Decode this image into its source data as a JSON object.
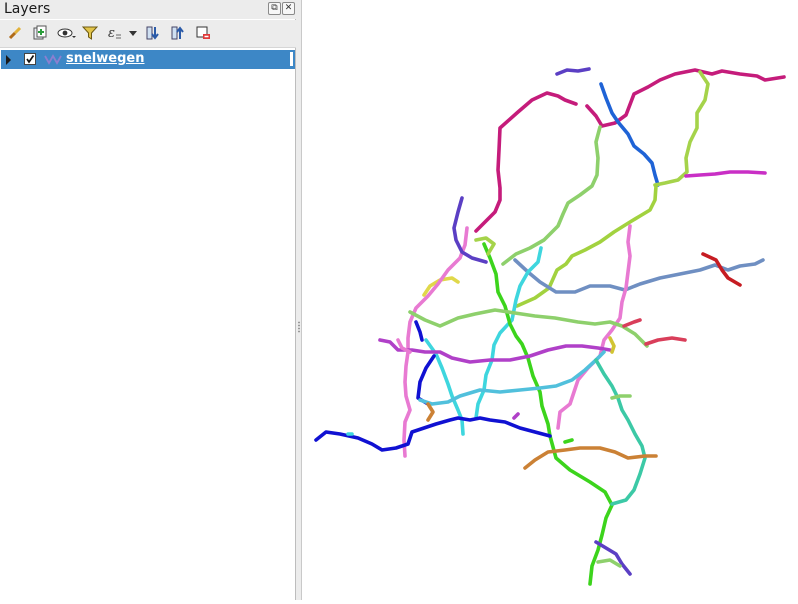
{
  "panel": {
    "title": "Layers",
    "float_icon": "float-panel-icon",
    "close_icon": "close-panel-icon"
  },
  "toolbar": {
    "buttons": [
      {
        "icon": "style-brush-icon"
      },
      {
        "icon": "add-group-icon"
      },
      {
        "icon": "visibility-eye-icon"
      },
      {
        "icon": "filter-funnel-icon"
      },
      {
        "icon": "filter-expression-icon"
      },
      {
        "icon": "expand-all-icon"
      },
      {
        "icon": "collapse-all-icon"
      },
      {
        "icon": "remove-layer-icon"
      }
    ]
  },
  "layers": [
    {
      "name": "snelwegen",
      "visible": true,
      "selected": true,
      "type": "line"
    }
  ],
  "map": {
    "road_colors": [
      "#c51c7b",
      "#5b3fc4",
      "#1f63d6",
      "#a5d34a",
      "#c92fc5",
      "#8ed06c",
      "#4fe39b",
      "#a2d23f",
      "#6f8fc2",
      "#e0d84a",
      "#3ed6de",
      "#3cd41c",
      "#e87ad2",
      "#b040c8",
      "#1011d2",
      "#51c0dc",
      "#d07fb6",
      "#cb8135",
      "#3cc9a6",
      "#c61c22",
      "#d93e5a",
      "#d1c433"
    ]
  }
}
